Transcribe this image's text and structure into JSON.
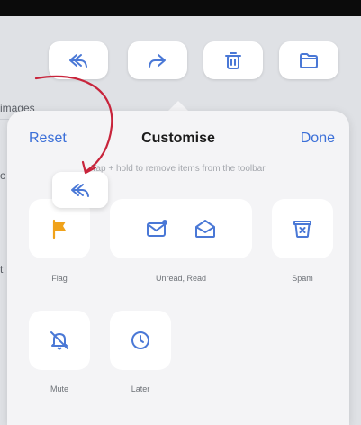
{
  "background": {
    "snippets": [
      "images",
      "c",
      "t"
    ]
  },
  "toolbar": {
    "buttons": [
      {
        "icon": "reply-icon"
      },
      {
        "icon": "forward-icon"
      },
      {
        "icon": "trash-icon"
      },
      {
        "icon": "folder-icon"
      }
    ]
  },
  "popover": {
    "reset_label": "Reset",
    "title": "Customise",
    "done_label": "Done",
    "hint": "Tap + hold to remove items from the toolbar",
    "tiles": [
      {
        "label": "Flag",
        "icon": "flag-icon"
      },
      {
        "label": "Unread, Read",
        "icons": [
          "unread-mail-icon",
          "read-mail-icon"
        ]
      },
      {
        "label": "Spam",
        "icon": "spam-icon"
      },
      {
        "label": "Mute",
        "icon": "mute-bell-icon"
      },
      {
        "label": "Later",
        "icon": "clock-icon"
      }
    ]
  },
  "drag_item": {
    "icon": "reply-icon"
  },
  "colors": {
    "accent": "#3b6fd8",
    "toolbar_icon": "#4a78d6",
    "flag": "#f0a21a",
    "arrow": "#c8243b"
  }
}
